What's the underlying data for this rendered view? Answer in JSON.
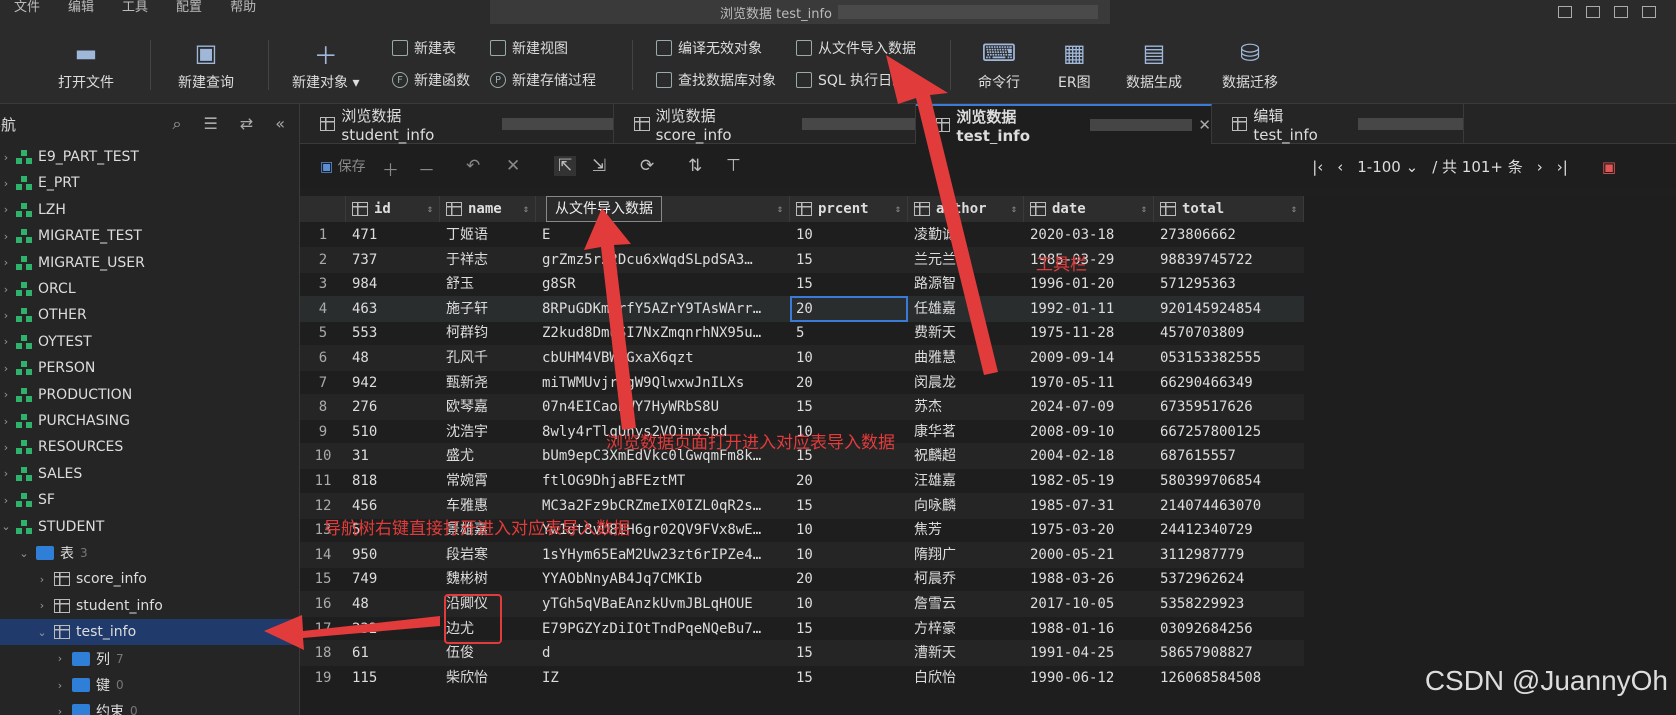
{
  "menu": {
    "items": [
      "文件",
      "编辑",
      "工具",
      "配置",
      "帮助"
    ]
  },
  "window": {
    "title": "浏览数据 test_info"
  },
  "toolbar": {
    "open_file": "打开文件",
    "new_query": "新建查询",
    "new_object": "新建对象",
    "new_table": "新建表",
    "new_view": "新建视图",
    "new_function": "新建函数",
    "new_procedure": "新建存储过程",
    "compile_invalid": "编译无效对象",
    "find_db_object": "查找数据库对象",
    "import_from_file": "从文件导入数据",
    "sql_log": "SQL 执行日志",
    "cmd": "命令行",
    "er": "ER图",
    "data_gen": "数据生成",
    "data_migrate": "数据迁移"
  },
  "nav": {
    "title": "导航",
    "schemas": [
      "E9_PART_TEST",
      "E_PRT",
      "LZH",
      "MIGRATE_TEST",
      "MIGRATE_USER",
      "ORCL",
      "OTHER",
      "OYTEST",
      "PERSON",
      "PRODUCTION",
      "PURCHASING",
      "RESOURCES",
      "SALES",
      "SF",
      "STUDENT"
    ],
    "tables_folder": "表",
    "tables_count": "3",
    "tables": [
      "score_info",
      "student_info",
      "test_info"
    ],
    "columns_folder": "列",
    "columns_count": "7",
    "keys_folder": "键",
    "keys_count": "0",
    "constraints_folder": "约束",
    "constraints_count": "0"
  },
  "tabs": [
    {
      "label": "浏览数据 student_info"
    },
    {
      "label": "浏览数据 score_info"
    },
    {
      "label": "浏览数据 test_info"
    },
    {
      "label": "编辑 test_info"
    }
  ],
  "gridbar": {
    "save": "保存",
    "page_range": "1-100",
    "page_total": "/ 共 101+ 条"
  },
  "grid": {
    "columns": [
      "id",
      "name",
      "",
      "prcent",
      "author",
      "date",
      "total"
    ],
    "rows": [
      [
        "1",
        "471",
        "丁姬语",
        "E",
        "10",
        "凌勤诚",
        "2020-03-18",
        "273806662"
      ],
      [
        "2",
        "737",
        "于祥志",
        "grZmz5r52Dcu6xWqdSLpdSA3…",
        "15",
        "兰元兰",
        "1985-03-29",
        "98839745722"
      ],
      [
        "3",
        "984",
        "舒玉",
        "g8SR",
        "15",
        "路源智",
        "1996-01-20",
        "571295363"
      ],
      [
        "4",
        "463",
        "施子轩",
        "8RPuGDKmirfY5AZrY9TAsWArr…",
        "20",
        "任雄嘉",
        "1992-01-11",
        "920145924854"
      ],
      [
        "5",
        "553",
        "柯群钧",
        "Z2kud8DmuSI7NxZmqnrhNX95u…",
        "5",
        "费新天",
        "1975-11-28",
        "4570703809"
      ],
      [
        "6",
        "48",
        "孔风千",
        "cbUHM4VBWrGxaX6qzt",
        "10",
        "曲雅慧",
        "2009-09-14",
        "053153382555"
      ],
      [
        "7",
        "942",
        "甄新尧",
        "miTWMUvjrjgW9QlwxwJnILXs",
        "20",
        "闵晨龙",
        "1970-05-11",
        "66290466349"
      ],
      [
        "8",
        "276",
        "欧琴嘉",
        "07n4EICaoEWY7HyWRbS8U",
        "15",
        "苏杰",
        "2024-07-09",
        "67359517626"
      ],
      [
        "9",
        "510",
        "沈浩宇",
        "8wly4rTlqUnys2VOjmxsbd",
        "10",
        "康华茗",
        "2008-09-10",
        "667257800125"
      ],
      [
        "10",
        "31",
        "盛尤",
        "bUm9epC3XmEdVkc0lGwqmFm8k…",
        "15",
        "祝麟超",
        "2004-02-18",
        "687615557"
      ],
      [
        "11",
        "818",
        "常婉霄",
        "ftlOG9DhjaBFEztMT",
        "20",
        "汪雄嘉",
        "1982-05-19",
        "580399706854"
      ],
      [
        "12",
        "456",
        "车雅惠",
        "MC3a2Fz9bCRZmeIX0IZL0qR2s…",
        "15",
        "向咏麟",
        "1985-07-31",
        "214074463070"
      ],
      [
        "13",
        "5",
        "景雄嘉",
        "Yw1dt8vU8IH6gr02QV9FVx8wE…",
        "10",
        "焦芳",
        "1975-03-20",
        "24412340729"
      ],
      [
        "14",
        "950",
        "段岩寒",
        "1sYHym65EaM2Uw23zt6rIPZe4…",
        "10",
        "隋翔广",
        "2000-05-21",
        "3112987779"
      ],
      [
        "15",
        "749",
        "魏彬树",
        "YYAObNnyAB4Jq7CMKIb",
        "20",
        "柯晨乔",
        "1988-03-26",
        "5372962624"
      ],
      [
        "16",
        "48",
        "沿卿仪",
        "yTGh5qVBaEAnzkUvmJBLqHOUE",
        "10",
        "詹雪云",
        "2017-10-05",
        "5358229923"
      ],
      [
        "17",
        "232",
        "边尤",
        "E79PGZYzDiIOtTndPqeNQeBu7…",
        "15",
        "方梓豪",
        "1988-01-16",
        "03092684256"
      ],
      [
        "18",
        "61",
        "伍俊",
        "d",
        "15",
        "漕新天",
        "1991-04-25",
        "58657908827"
      ],
      [
        "19",
        "115",
        "柴欣怡",
        "IZ",
        "15",
        "白欣怡",
        "1990-06-12",
        "126068584508"
      ]
    ]
  },
  "tooltip": "从文件导入数据",
  "annotations": {
    "a1": "工具栏",
    "a2": "浏览数据页面打开进入对应表导入数据",
    "a3": "导航树右键直接打开进入对应表导入数据"
  },
  "watermark": "CSDN @JuannyOh",
  "colors": {
    "accent": "#3b7bd8",
    "annotation": "#e23b3b",
    "db_icon": "#2fb26b"
  }
}
